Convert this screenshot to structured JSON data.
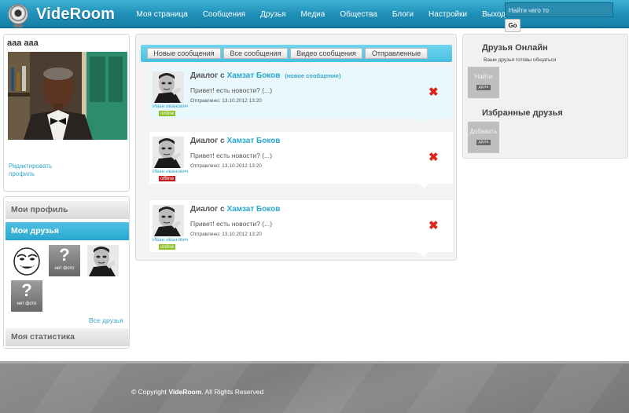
{
  "header": {
    "logo_text": "VideRoom",
    "nav": [
      "Моя страница",
      "Сообщения",
      "Друзья",
      "Медиа",
      "Общества",
      "Блоги",
      "Настройки",
      "Выход"
    ],
    "search_placeholder": "Найти чего то",
    "search_button": "Go"
  },
  "profile": {
    "name": "ааа ааа",
    "edit_link": "Редактировать профиль"
  },
  "sidebar": {
    "my_profile": "Мои профиль",
    "my_friends": "Мои друзья",
    "no_photo": "нет фото",
    "all_friends": "Все друзья",
    "my_stats": "Моя статистика"
  },
  "messages": {
    "tabs": [
      "Новые сообщения",
      "Все сообщения",
      "Видео сообщения",
      "Отправленные"
    ],
    "dialogs": [
      {
        "title_prefix": "Диалог с",
        "name": "Хамзат Боков",
        "new_label": "(новое сообщение)",
        "text": "Привет! есть новости? (...)",
        "date": "Отправлено: 13.10.2012 13:20",
        "sender": "Иван иванович",
        "status": "online"
      },
      {
        "title_prefix": "Диалог с",
        "name": "Хамзат Боков",
        "new_label": "",
        "text": "Привет! есть новости? (...)",
        "date": "Отправлено: 13.10.2012 13:20",
        "sender": "Иван иванович",
        "status": "offline"
      },
      {
        "title_prefix": "Диалог с",
        "name": "Хамзат Боков",
        "new_label": "",
        "text": "Привет! есть новости? (...)",
        "date": "Отправлено: 13.10.2012 13:20",
        "sender": "Иван иванович",
        "status": "online"
      }
    ],
    "delete_glyph": "✖"
  },
  "right": {
    "online_title": "Друзья Онлайн",
    "online_sub": "Ваши друзья готовы общаться",
    "find_button": "Найти",
    "find_sub": "друга",
    "favorites_title": "Избранные друзья",
    "add_button": "Добавить",
    "add_sub": "друга"
  },
  "footer": {
    "prefix": "© Copyright",
    "brand": "VideRoom",
    "suffix": ". All Rights Reserved"
  },
  "colors": {
    "accent": "#2aa7cf",
    "online": "#8cbf26",
    "offline": "#c41a1a",
    "delete": "#d9261c"
  }
}
